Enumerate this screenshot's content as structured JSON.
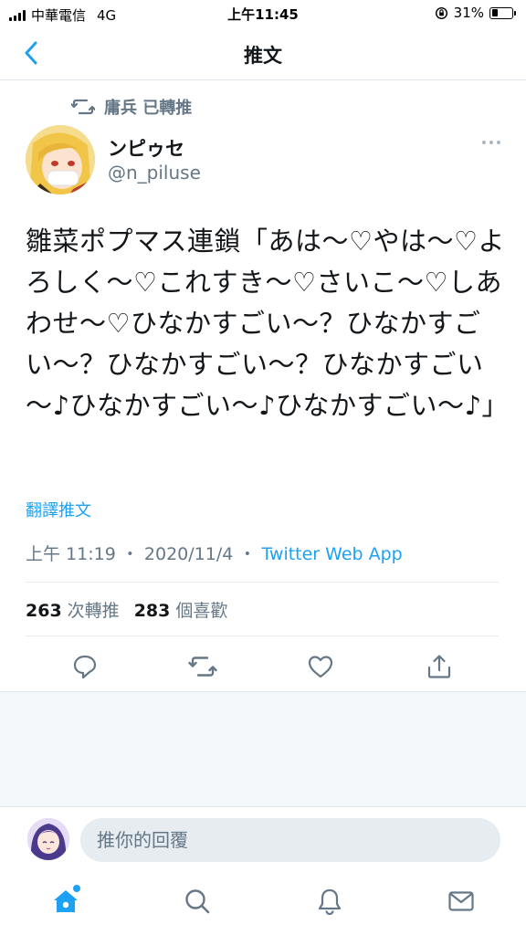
{
  "status_bar": {
    "carrier": "中華電信",
    "network": "4G",
    "time": "上午11:45",
    "battery": "31%",
    "battery_level": 0.31
  },
  "nav": {
    "title": "推文"
  },
  "retweet": {
    "label": "庸兵 已轉推"
  },
  "author": {
    "name": "ンピゥセ",
    "handle": "@n_piluse"
  },
  "tweet": {
    "text": "雛菜ポプマス連鎖「あは～♡やは～♡よろしく～♡これすき～♡さいこ～♡しあわせ～♡ひなかすごい～？ひなかすごい～？ひなかすごい～？ひなかすごい～♪ひなかすごい～♪ひなかすごい～♪」",
    "translate": "翻譯推文",
    "time": "上午 11:19",
    "date": "2020/11/4",
    "sep": "・",
    "app": "Twitter Web App"
  },
  "stats": {
    "retweets_count": "263",
    "retweets_label": "次轉推",
    "likes_count": "283",
    "likes_label": "個喜歡"
  },
  "reply": {
    "placeholder": "推你的回覆"
  },
  "colors": {
    "accent": "#1da1f2",
    "secondary_text": "#657786",
    "icon_gray": "#657786"
  }
}
